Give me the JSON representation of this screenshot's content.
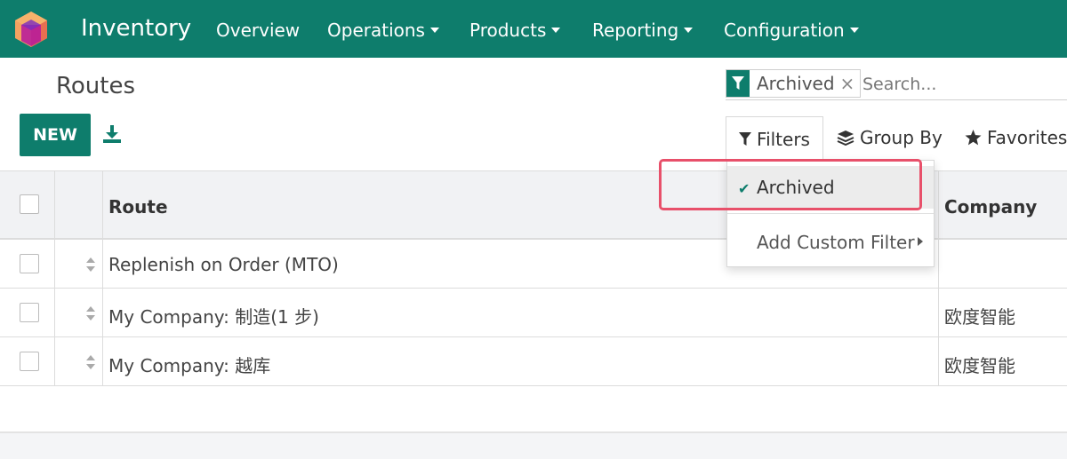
{
  "navbar": {
    "app_name": "Inventory",
    "menu": [
      "Overview",
      "Operations",
      "Products",
      "Reporting",
      "Configuration"
    ],
    "bg_color": "#0e7d6c"
  },
  "control_panel": {
    "title": "Routes",
    "new_label": "NEW",
    "search": {
      "facet_label": "Archived",
      "facet_close": "×",
      "placeholder": "Search..."
    },
    "filters_label": "Filters",
    "group_by_label": "Group By",
    "favorites_label": "Favorites"
  },
  "filters_dropdown": {
    "active_item": "Archived",
    "custom_filter_label": "Add Custom Filter"
  },
  "table": {
    "columns": [
      "Route",
      "Company"
    ],
    "rows": [
      {
        "route": "Replenish on Order (MTO)",
        "company": ""
      },
      {
        "route": "My Company: 制造(1 步)",
        "company": "欧度智能"
      },
      {
        "route": "My Company: 越库",
        "company": "欧度智能"
      }
    ]
  },
  "annotation": {
    "highlight_color": "#e8506a"
  }
}
